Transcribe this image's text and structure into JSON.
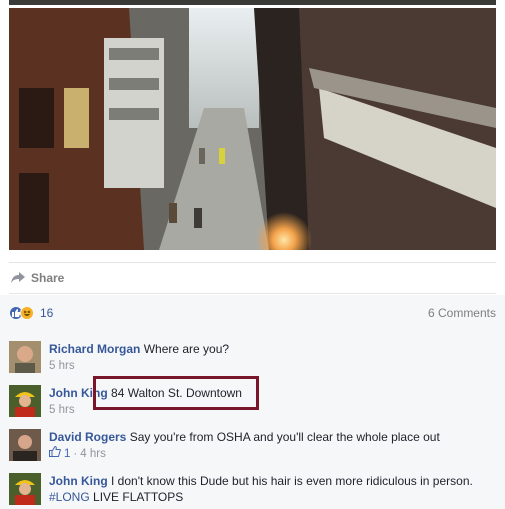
{
  "post": {
    "share_label": "Share",
    "reactions": {
      "icons": [
        "like-icon",
        "haha-icon"
      ],
      "count": "16"
    },
    "comments_count": "6 Comments"
  },
  "comments": [
    {
      "author": "Richard Morgan",
      "text": "Where are you?",
      "time": "5 hrs"
    },
    {
      "author": "John King",
      "text": "84 Walton St. Downtown",
      "time": "5 hrs"
    },
    {
      "author": "David Rogers",
      "text": "Say you're from OSHA and you'll clear the whole place out",
      "likes": "1",
      "separator": "·",
      "time": "4 hrs"
    },
    {
      "author": "John King",
      "text": "I don't know this Dude but his hair is even more ridiculous in person.",
      "hashtag": "#LONG",
      "text2": " LIVE FLATTOPS"
    }
  ],
  "colors": {
    "link": "#365899",
    "annotation_box": "#7a1629",
    "panel_bg": "#f6f7f9"
  }
}
